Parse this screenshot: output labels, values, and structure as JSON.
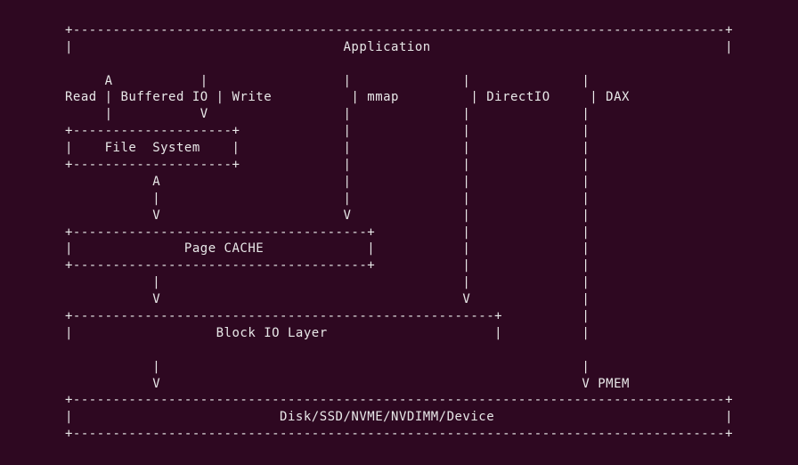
{
  "diagram": {
    "lines": [
      "+----------------------------------------------------------------------------------+",
      "|                                  Application                                     |",
      "",
      "     A           |                 |              |              |",
      "Read | Buffered IO | Write          | mmap         | DirectIO     | DAX",
      "     |           V                 |              |              |",
      "+--------------------+             |              |              |",
      "|    File  System    |             |              |              |",
      "+--------------------+             |              |              |",
      "           A                       |              |              |",
      "           |                       |              |              |",
      "           V                       V              |              |",
      "+-------------------------------------+           |              |",
      "|              Page CACHE             |           |              |",
      "+-------------------------------------+           |              |",
      "           |                                      |              |",
      "           V                                      V              |",
      "+-----------------------------------------------------+          |",
      "|                  Block IO Layer                     |          |",
      "",
      "           |                                                     |",
      "           V                                                     V PMEM",
      "+----------------------------------------------------------------------------------+",
      "|                          Disk/SSD/NVME/NVDIMM/Device                             |",
      "+----------------------------------------------------------------------------------+"
    ],
    "labels": {
      "application": "Application",
      "read": "Read",
      "bufferedIO": "Buffered IO",
      "write": "Write",
      "mmap": "mmap",
      "directIO": "DirectIO",
      "dax": "DAX",
      "fileSystem": "File System",
      "pageCache": "Page CACHE",
      "blockIOLayer": "Block IO Layer",
      "pmem": "PMEM",
      "storage": "Disk/SSD/NVME/NVDIMM/Device"
    }
  }
}
